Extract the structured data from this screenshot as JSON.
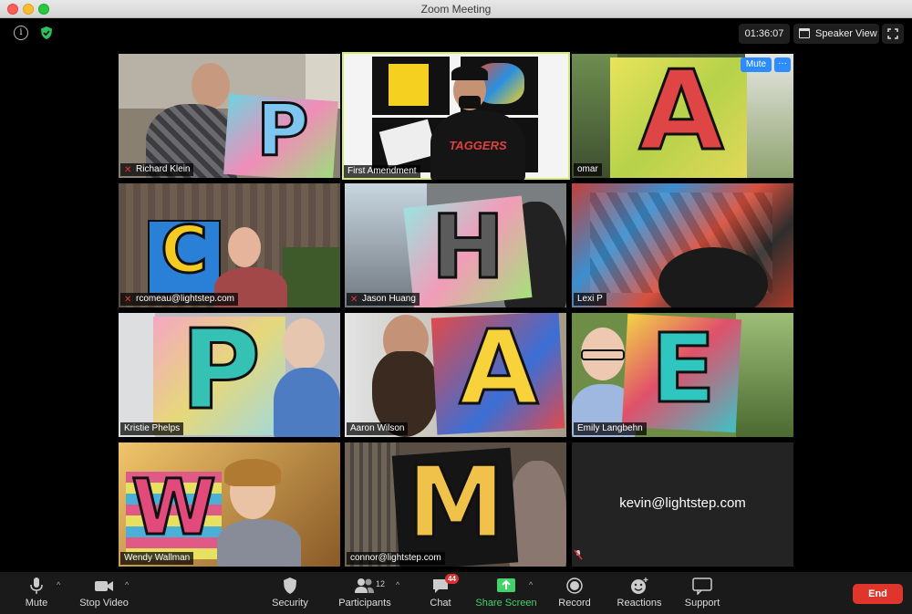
{
  "window": {
    "title": "Zoom Meeting"
  },
  "topbar": {
    "timer": "01:36:07",
    "view_label": "Speaker View"
  },
  "tile_controls": {
    "mute_label": "Mute",
    "more_label": "···"
  },
  "participants": [
    {
      "name": "Richard Klein",
      "letter": "P",
      "muted": true
    },
    {
      "name": "First Amendment",
      "letter": "",
      "muted": false,
      "active": true
    },
    {
      "name": "omar",
      "letter": "A",
      "muted": false
    },
    {
      "name": "rcomeau@lightstep.com",
      "letter": "C",
      "muted": true
    },
    {
      "name": "Jason Huang",
      "letter": "H",
      "muted": true
    },
    {
      "name": "Lexi P",
      "letter": "",
      "muted": false
    },
    {
      "name": "Kristie Phelps",
      "letter": "P",
      "muted": false
    },
    {
      "name": "Aaron Wilson",
      "letter": "A",
      "muted": false
    },
    {
      "name": "Emily Langbehn",
      "letter": "E",
      "muted": false
    },
    {
      "name": "Wendy Wallman",
      "letter": "W",
      "muted": false
    },
    {
      "name": "connor@lightstep.com",
      "letter": "M",
      "muted": false
    },
    {
      "name": "kevin@lightstep.com",
      "letter": "",
      "muted": true,
      "video_off": true
    }
  ],
  "first_amendment_shirt": "TAGGERS",
  "toolbar": {
    "mute_label": "Mute",
    "stop_video_label": "Stop Video",
    "security_label": "Security",
    "participants_label": "Participants",
    "participants_count": "12",
    "chat_label": "Chat",
    "chat_badge": "44",
    "share_label": "Share Screen",
    "record_label": "Record",
    "reactions_label": "Reactions",
    "support_label": "Support",
    "end_label": "End"
  },
  "colors": {
    "active_border": "#d6ec6b",
    "share_green": "#3fd36a",
    "end_red": "#e0352b",
    "accent_blue": "#2d8cff"
  }
}
